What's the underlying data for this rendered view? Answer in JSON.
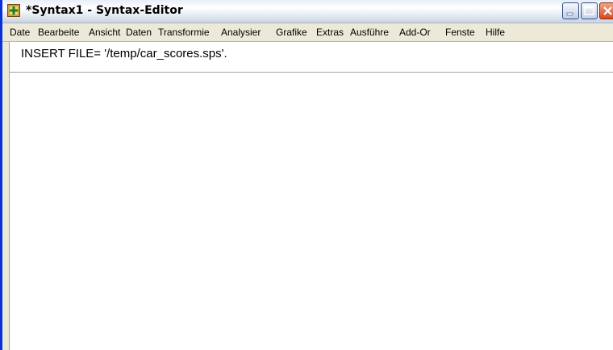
{
  "window": {
    "title": "*Syntax1 - Syntax-Editor"
  },
  "menubar": {
    "items": [
      {
        "label": "Date"
      },
      {
        "label": "Bearbeite"
      },
      {
        "label": "Ansicht"
      },
      {
        "label": "Daten"
      },
      {
        "label": "Transformie"
      },
      {
        "label": "Analysier"
      },
      {
        "label": "Grafike"
      },
      {
        "label": "Extras"
      },
      {
        "label": "Ausführe"
      },
      {
        "label": "Add-Or"
      },
      {
        "label": "Fenste"
      },
      {
        "label": "Hilfe"
      }
    ]
  },
  "editor": {
    "lines": [
      "INSERT FILE= '/temp/car_scores.sps'."
    ]
  },
  "icons": {
    "app": "spss-syntax-icon",
    "minimize": "minimize-icon",
    "maximize": "maximize-icon",
    "close": "close-icon"
  }
}
